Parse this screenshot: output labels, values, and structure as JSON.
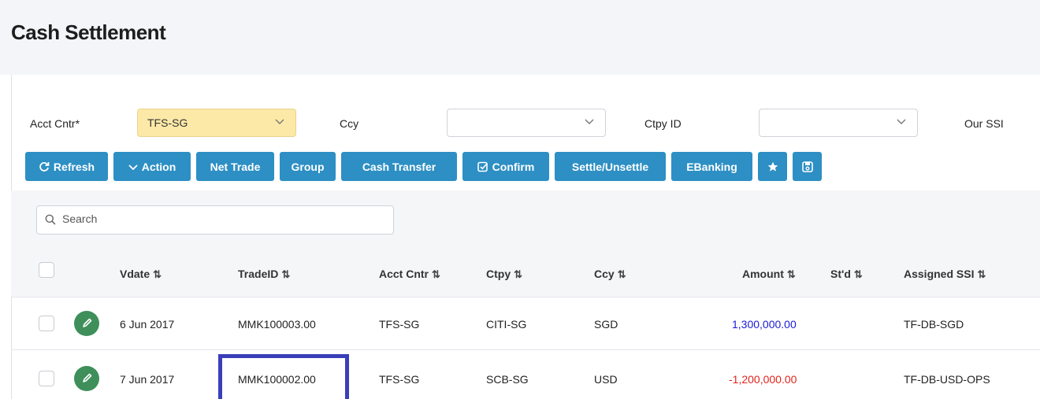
{
  "page": {
    "title": "Cash Settlement"
  },
  "filters": {
    "acct_cntr": {
      "label": "Acct Cntr*",
      "value": "TFS-SG"
    },
    "ccy": {
      "label": "Ccy",
      "value": ""
    },
    "ctpy_id": {
      "label": "Ctpy ID",
      "value": ""
    },
    "our_ssi": {
      "label": "Our SSI"
    }
  },
  "toolbar": {
    "refresh": "Refresh",
    "action": "Action",
    "net_trade": "Net Trade",
    "group": "Group",
    "cash_transfer": "Cash Transfer",
    "confirm": "Confirm",
    "settle_unsettle": "Settle/Unsettle",
    "ebanking": "EBanking",
    "icons": [
      "refresh-icon",
      "chevron-down-icon",
      "check-square-icon",
      "star-icon",
      "save-icon"
    ],
    "color": "#2d8fc4"
  },
  "search": {
    "placeholder": "Search"
  },
  "table": {
    "headers": {
      "vdate": "Vdate",
      "trade_id": "TradeID",
      "acct_cntr": "Acct Cntr",
      "ctpy": "Ctpy",
      "ccy": "Ccy",
      "amount": "Amount",
      "stld": "St'd",
      "assigned_ssi": "Assigned SSI"
    },
    "sort_glyph": "⇅",
    "rows": [
      {
        "vdate": "6 Jun 2017",
        "trade_id": "MMK100003.00",
        "acct_cntr": "TFS-SG",
        "ctpy": "CITI-SG",
        "ccy": "SGD",
        "amount": "1,300,000.00",
        "stld": "",
        "assigned_ssi": "TF-DB-SGD"
      },
      {
        "vdate": "7 Jun 2017",
        "trade_id": "MMK100002.00",
        "acct_cntr": "TFS-SG",
        "ctpy": "SCB-SG",
        "ccy": "USD",
        "amount": "-1,200,000.00",
        "stld": "",
        "assigned_ssi": "TF-DB-USD-OPS"
      }
    ]
  },
  "colors": {
    "positive": "#1a1ad6",
    "negative": "#e0241c",
    "edit_button": "#3e8f5a",
    "selection_box": "#3a3fb8",
    "acct_highlight": "#fde9a7"
  }
}
